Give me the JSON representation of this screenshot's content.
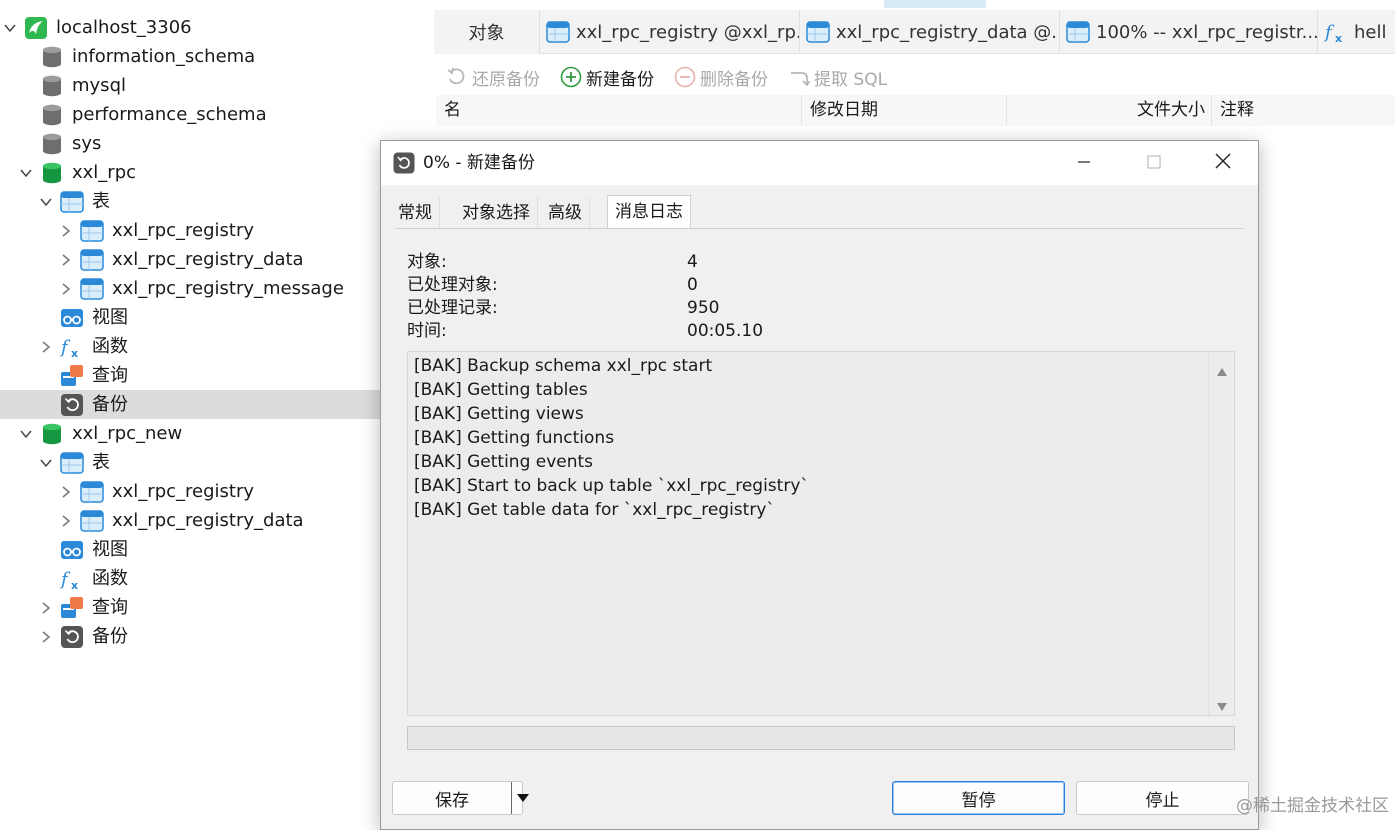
{
  "sidebar": {
    "connection": "localhost_3306",
    "system_databases": [
      "information_schema",
      "mysql",
      "performance_schema",
      "sys"
    ],
    "db1": {
      "name": "xxl_rpc",
      "tables_label": "表",
      "tables": [
        "xxl_rpc_registry",
        "xxl_rpc_registry_data",
        "xxl_rpc_registry_message"
      ],
      "views_label": "视图",
      "functions_label": "函数",
      "queries_label": "查询",
      "backups_label": "备份"
    },
    "db2": {
      "name": "xxl_rpc_new",
      "tables_label": "表",
      "tables": [
        "xxl_rpc_registry",
        "xxl_rpc_registry_data"
      ],
      "views_label": "视图",
      "functions_label": "函数",
      "queries_label": "查询",
      "backups_label": "备份"
    }
  },
  "tabs": {
    "objects": "对象",
    "items": [
      {
        "label": "xxl_rpc_registry @xxl_rp...",
        "icon": "table-icon"
      },
      {
        "label": "xxl_rpc_registry_data @...",
        "icon": "table-icon"
      },
      {
        "label": "100% -- xxl_rpc_registr...",
        "icon": "table-icon"
      },
      {
        "label": "hell",
        "icon": "function-icon"
      }
    ]
  },
  "toolbar": {
    "restore": "还原备份",
    "new_backup": "新建备份",
    "delete_backup": "删除备份",
    "extract_sql": "提取 SQL"
  },
  "columns": {
    "name": "名",
    "modified": "修改日期",
    "size": "文件大小",
    "comment": "注释"
  },
  "dialog": {
    "title": "0% - 新建备份",
    "tabs": [
      "常规",
      "对象选择",
      "高级",
      "消息日志"
    ],
    "active_tab": "消息日志",
    "stats": {
      "objects_label": "对象:",
      "objects_value": "4",
      "processed_objects_label": "已处理对象:",
      "processed_objects_value": "0",
      "processed_records_label": "已处理记录:",
      "processed_records_value": "950",
      "time_label": "时间:",
      "time_value": "00:05.10"
    },
    "log": [
      "[BAK] Backup schema xxl_rpc start",
      "[BAK] Getting tables",
      "[BAK] Getting views",
      "[BAK] Getting functions",
      "[BAK] Getting events",
      "[BAK] Start to back up table `xxl_rpc_registry`",
      "[BAK] Get table data for `xxl_rpc_registry`"
    ],
    "progress_percent": 0,
    "buttons": {
      "save": "保存",
      "pause": "暂停",
      "stop": "停止"
    }
  },
  "watermark": "@稀土掘金技术社区",
  "colors": {
    "db_green": "#1aa84b",
    "table_blue": "#2a8ad8",
    "selected_row": "#dcdcdc",
    "primary_border": "#2a7de1",
    "add_green": "#2e9d3e"
  }
}
